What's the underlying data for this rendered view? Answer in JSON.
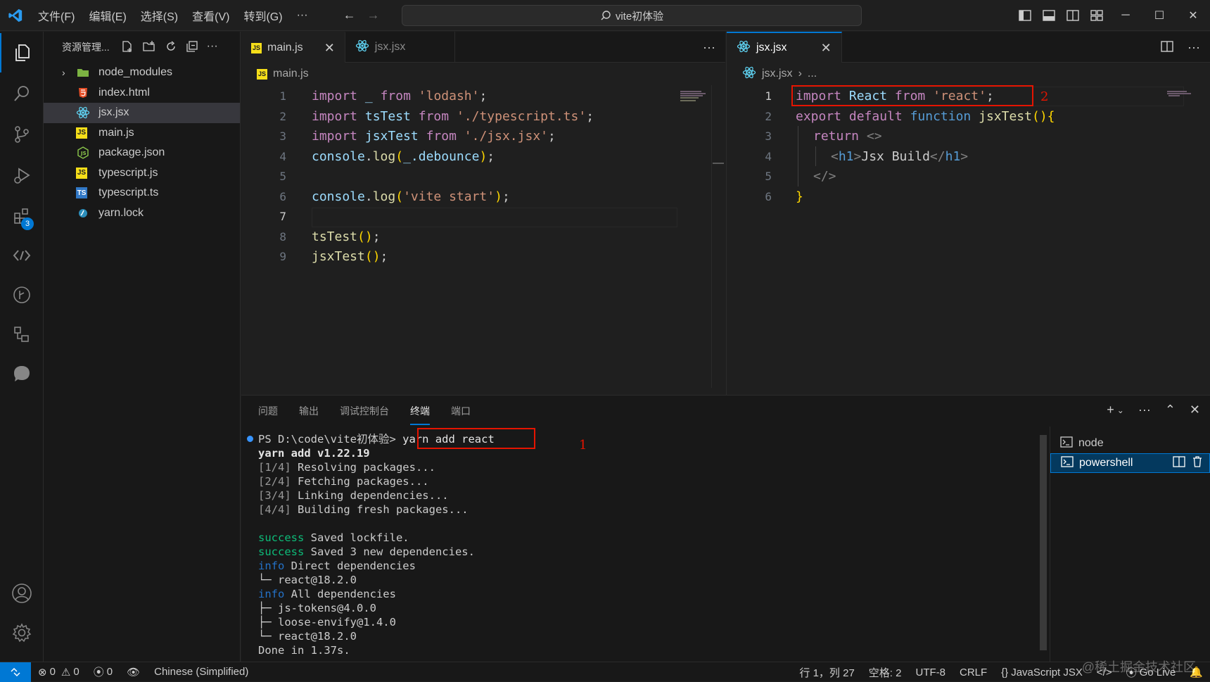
{
  "titlebar": {
    "menu": [
      "文件(F)",
      "编辑(E)",
      "选择(S)",
      "查看(V)",
      "转到(G)",
      "···"
    ],
    "search": "vite初体验"
  },
  "activity_bar": {
    "extensions_badge": "3"
  },
  "explorer": {
    "title": "资源管理...",
    "items": [
      {
        "label": "node_modules",
        "type": "folder"
      },
      {
        "label": "index.html",
        "type": "html"
      },
      {
        "label": "jsx.jsx",
        "type": "react",
        "selected": true
      },
      {
        "label": "main.js",
        "type": "js"
      },
      {
        "label": "package.json",
        "type": "json"
      },
      {
        "label": "typescript.js",
        "type": "js"
      },
      {
        "label": "typescript.ts",
        "type": "ts"
      },
      {
        "label": "yarn.lock",
        "type": "yarn"
      }
    ]
  },
  "editor_left": {
    "tabs": [
      {
        "label": "main.js",
        "close": "✕"
      },
      {
        "label": "jsx.jsx"
      }
    ],
    "more": "···",
    "breadcrumb": "main.js",
    "line_numbers": [
      "1",
      "2",
      "3",
      "4",
      "5",
      "6",
      "7",
      "8",
      "9"
    ],
    "lines": {
      "l1_a": "import",
      "l1_b": "_",
      "l1_c": "from",
      "l1_d": "'lodash'",
      "l1_e": ";",
      "l2_a": "import",
      "l2_b": "tsTest",
      "l2_c": "from",
      "l2_d": "'./typescript.ts'",
      "l2_e": ";",
      "l3_a": "import",
      "l3_b": "jsxTest",
      "l3_c": "from",
      "l3_d": "'./jsx.jsx'",
      "l3_e": ";",
      "l4_a": "console",
      "l4_b": ".",
      "l4_c": "log",
      "l4_d": "(",
      "l4_e": "_",
      "l4_f": ".debounce",
      "l4_g": ")",
      "l4_h": ";",
      "l6_a": "console",
      "l6_b": ".",
      "l6_c": "log",
      "l6_d": "(",
      "l6_e": "'vite start'",
      "l6_f": ")",
      "l6_g": ";",
      "l8_a": "tsTest",
      "l8_b": "()",
      "l8_c": ";",
      "l9_a": "jsxTest",
      "l9_b": "()",
      "l9_c": ";"
    }
  },
  "editor_right": {
    "tab": {
      "label": "jsx.jsx",
      "close": "✕"
    },
    "more": "···",
    "breadcrumb": "jsx.jsx",
    "breadcrumb_sep": "›",
    "breadcrumb_more": "...",
    "line_numbers": [
      "1",
      "2",
      "3",
      "4",
      "5",
      "6"
    ],
    "lines": {
      "l1_a": "import",
      "l1_b": "React",
      "l1_c": "from",
      "l1_d": "'react'",
      "l1_e": ";",
      "l2_a": "export",
      "l2_b": "default",
      "l2_c": "function",
      "l2_d": "jsxTest",
      "l2_e": "()",
      "l2_f": "{",
      "l3_a": "return",
      "l3_b": "<>",
      "l4_a": "<",
      "l4_b": "h1",
      "l4_c": ">",
      "l4_d": "Jsx Build",
      "l4_e": "</",
      "l4_f": "h1",
      "l4_g": ">",
      "l5_a": "</>",
      "l6_a": "}"
    },
    "annotation": "2"
  },
  "panel": {
    "tabs": [
      "问题",
      "输出",
      "调试控制台",
      "终端",
      "端口"
    ],
    "active_tab": "终端",
    "terminal": {
      "prompt": "PS D:\\code\\vite初体验> ",
      "command": "yarn add react",
      "annotation": "1",
      "lines": [
        {
          "parts": [
            {
              "cls": "bold",
              "text": "yarn add v1.22.19"
            }
          ]
        },
        {
          "parts": [
            {
              "cls": "dim",
              "text": "[1/4]"
            },
            {
              "cls": "",
              "text": " Resolving packages..."
            }
          ]
        },
        {
          "parts": [
            {
              "cls": "dim",
              "text": "[2/4]"
            },
            {
              "cls": "",
              "text": " Fetching packages..."
            }
          ]
        },
        {
          "parts": [
            {
              "cls": "dim",
              "text": "[3/4]"
            },
            {
              "cls": "",
              "text": " Linking dependencies..."
            }
          ]
        },
        {
          "parts": [
            {
              "cls": "dim",
              "text": "[4/4]"
            },
            {
              "cls": "",
              "text": " Building fresh packages..."
            }
          ]
        },
        {
          "parts": [
            {
              "cls": "",
              "text": ""
            }
          ]
        },
        {
          "parts": [
            {
              "cls": "grn",
              "text": "success"
            },
            {
              "cls": "",
              "text": " Saved lockfile."
            }
          ]
        },
        {
          "parts": [
            {
              "cls": "grn",
              "text": "success"
            },
            {
              "cls": "",
              "text": " Saved 3 new dependencies."
            }
          ]
        },
        {
          "parts": [
            {
              "cls": "blu",
              "text": "info"
            },
            {
              "cls": "",
              "text": " Direct dependencies"
            }
          ]
        },
        {
          "parts": [
            {
              "cls": "",
              "text": "└─ react@18.2.0"
            }
          ]
        },
        {
          "parts": [
            {
              "cls": "blu",
              "text": "info"
            },
            {
              "cls": "",
              "text": " All dependencies"
            }
          ]
        },
        {
          "parts": [
            {
              "cls": "",
              "text": "├─ js-tokens@4.0.0"
            }
          ]
        },
        {
          "parts": [
            {
              "cls": "",
              "text": "├─ loose-envify@1.4.0"
            }
          ]
        },
        {
          "parts": [
            {
              "cls": "",
              "text": "└─ react@18.2.0"
            }
          ]
        },
        {
          "parts": [
            {
              "cls": "",
              "text": "Done in 1.37s."
            }
          ]
        }
      ]
    },
    "terminal_list": [
      {
        "label": "node",
        "selected": false
      },
      {
        "label": "powershell",
        "selected": true
      }
    ]
  },
  "statusbar": {
    "errors": "0",
    "warnings": "0",
    "ports": "0",
    "language_pack": "Chinese (Simplified)",
    "position": "行 1，列 27",
    "spaces": "空格: 2",
    "encoding": "UTF-8",
    "eol": "CRLF",
    "language": "JavaScript JSX",
    "golive": "Go Live"
  },
  "watermark": "@稀土掘金技术社区",
  "colors": {
    "accent": "#0078d4",
    "annotation_red": "#e51400",
    "keyword": "#c586c0",
    "string": "#ce9178",
    "function": "#dcdcaa",
    "variable": "#9cdcfe"
  }
}
